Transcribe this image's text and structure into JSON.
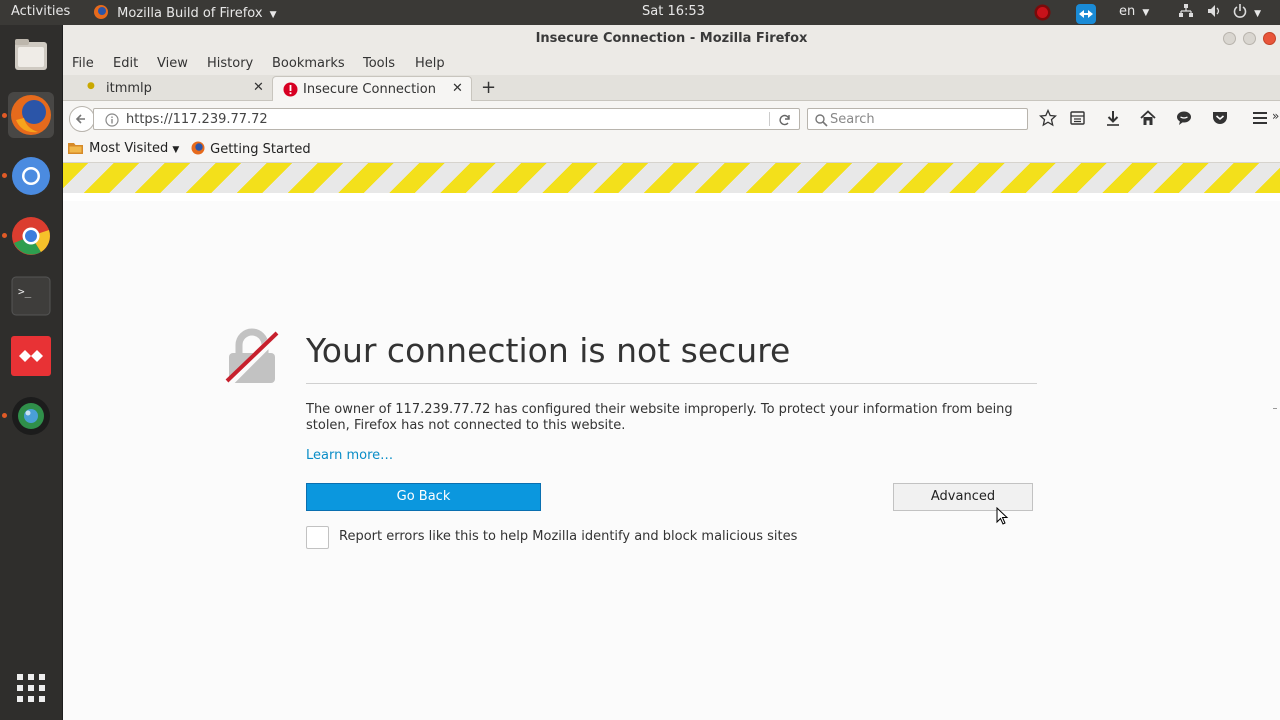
{
  "topbar": {
    "activities": "Activities",
    "app_menu": "Mozilla Build of Firefox",
    "clock": "Sat 16:53",
    "language": "en"
  },
  "window": {
    "title": "Insecure Connection - Mozilla Firefox"
  },
  "menu": {
    "file": "File",
    "edit": "Edit",
    "view": "View",
    "history": "History",
    "bookmarks": "Bookmarks",
    "tools": "Tools",
    "help": "Help"
  },
  "tabs": [
    {
      "label": "itmmlp"
    },
    {
      "label": "Insecure Connection"
    }
  ],
  "navbar": {
    "url": "https://117.239.77.72",
    "search_placeholder": "Search"
  },
  "bookmarks_bar": {
    "most_visited": "Most Visited",
    "getting_started": "Getting Started"
  },
  "error_page": {
    "title": "Your connection is not secure",
    "description": "The owner of 117.239.77.72 has configured their website improperly. To protect your information from being stolen, Firefox has not connected to this website.",
    "learn_more": "Learn more…",
    "go_back": "Go Back",
    "advanced": "Advanced",
    "report_label": "Report errors like this to help Mozilla identify and block malicious sites"
  },
  "colors": {
    "accent": "#0b97de",
    "warning_stripe": "#f3e01b",
    "link": "#0a8dc7"
  }
}
